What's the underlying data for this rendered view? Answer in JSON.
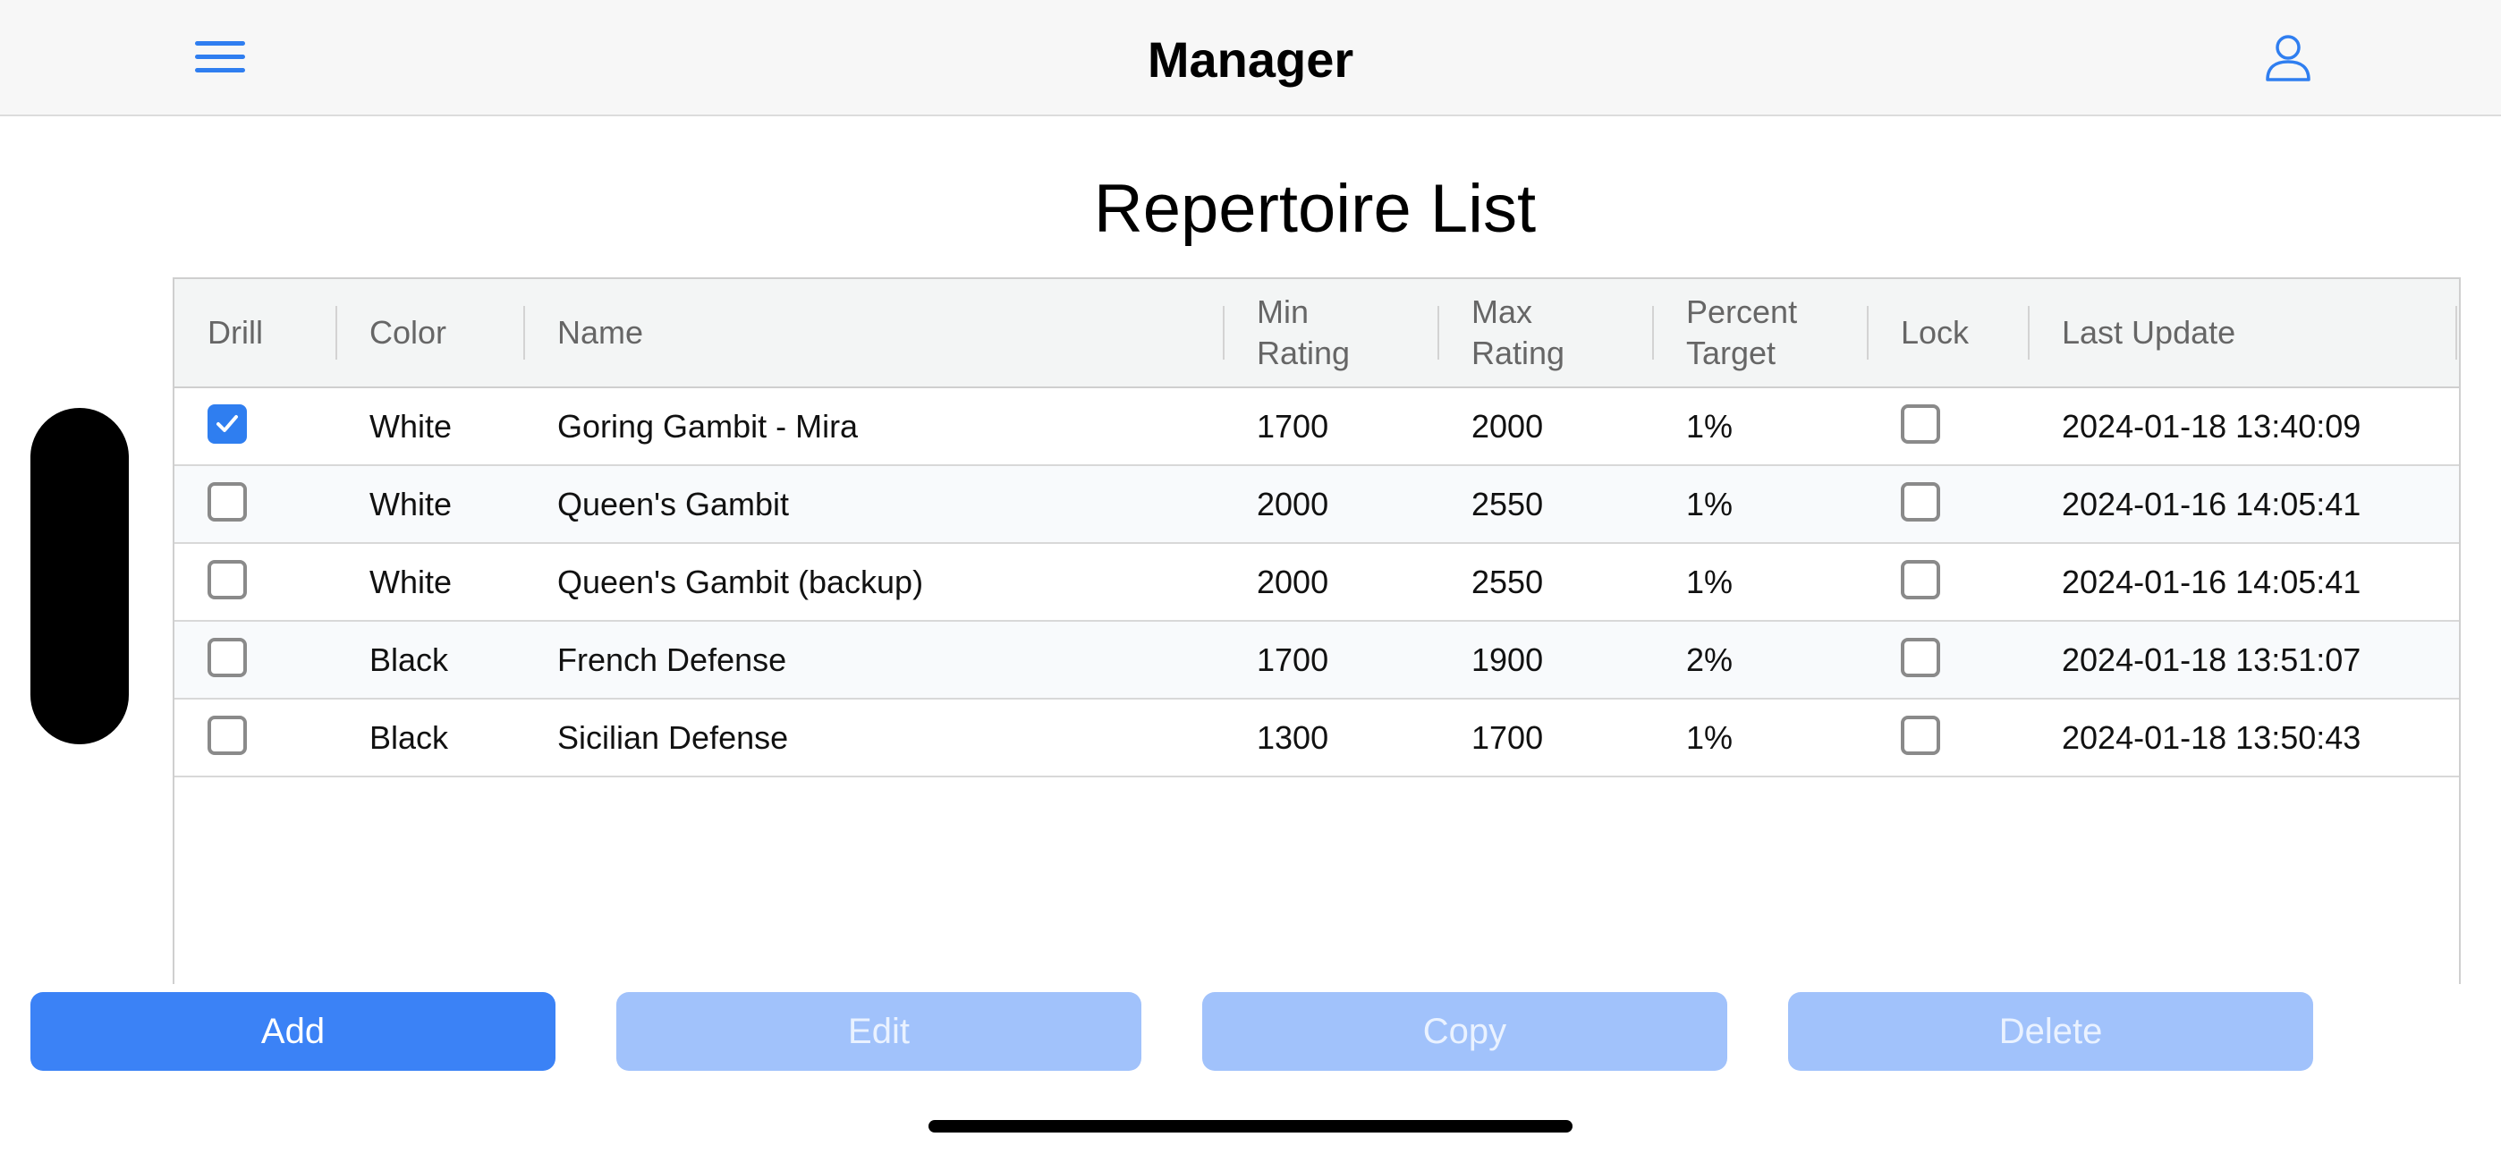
{
  "navbar": {
    "title": "Manager",
    "menu_icon": "hamburger-icon",
    "user_icon": "user-icon",
    "accent_color": "#2f7ef0"
  },
  "page": {
    "title": "Repertoire List"
  },
  "table": {
    "headers": {
      "drill": "Drill",
      "color": "Color",
      "name": "Name",
      "min_rating_1": "Min",
      "min_rating_2": "Rating",
      "max_rating_1": "Max",
      "max_rating_2": "Rating",
      "percent_target_1": "Percent",
      "percent_target_2": "Target",
      "lock": "Lock",
      "last_update": "Last Update"
    },
    "rows": [
      {
        "drill": true,
        "color": "White",
        "name": "Goring Gambit - Mira",
        "min_rating": "1700",
        "max_rating": "2000",
        "percent_target": "1%",
        "lock": false,
        "last_update": "2024-01-18 13:40:09"
      },
      {
        "drill": false,
        "color": "White",
        "name": "Queen's Gambit",
        "min_rating": "2000",
        "max_rating": "2550",
        "percent_target": "1%",
        "lock": false,
        "last_update": "2024-01-16 14:05:41"
      },
      {
        "drill": false,
        "color": "White",
        "name": "Queen's Gambit (backup)",
        "min_rating": "2000",
        "max_rating": "2550",
        "percent_target": "1%",
        "lock": false,
        "last_update": "2024-01-16 14:05:41"
      },
      {
        "drill": false,
        "color": "Black",
        "name": "French Defense",
        "min_rating": "1700",
        "max_rating": "1900",
        "percent_target": "2%",
        "lock": false,
        "last_update": "2024-01-18 13:51:07"
      },
      {
        "drill": false,
        "color": "Black",
        "name": "Sicilian Defense",
        "min_rating": "1300",
        "max_rating": "1700",
        "percent_target": "1%",
        "lock": false,
        "last_update": "2024-01-18 13:50:43"
      }
    ]
  },
  "actions": {
    "add": "Add",
    "edit": "Edit",
    "copy": "Copy",
    "delete": "Delete"
  }
}
